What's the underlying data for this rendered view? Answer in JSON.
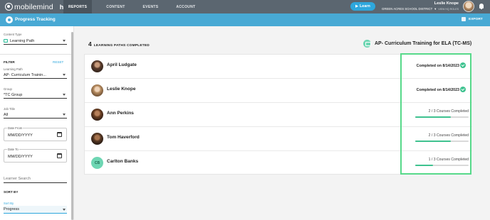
{
  "topbar": {
    "logo_text": "mobilemind",
    "logo_hq": "hq",
    "nav": [
      {
        "label": "REPORTS",
        "active": true
      },
      {
        "label": "CONTENT",
        "active": false
      },
      {
        "label": "EVENTS",
        "active": false
      },
      {
        "label": "ACCOUNT",
        "active": false
      }
    ],
    "learn_label": "Learn",
    "user_name": "Leslie Knope",
    "user_org": "GREEN ACRES SCHOOL DISTRICT",
    "view_roles": "VIEW HQ ROLES"
  },
  "title_bar": {
    "title": "Progress Tracking",
    "export_label": "EXPORT"
  },
  "sidebar": {
    "content_type_label": "Content Type",
    "content_type_value": "Learning Path",
    "filter_heading": "FILTER",
    "reset_label": "RESET",
    "learning_path_label": "Learning Path",
    "learning_path_value": "AP- Curriculum Trainin...",
    "group_label": "Group",
    "group_value": "*TC Group",
    "job_title_label": "Job Title",
    "job_title_value": "All",
    "date_from_label": "Date From",
    "date_from_placeholder": "MM/DD/YYYY",
    "date_to_label": "Date To",
    "date_to_placeholder": "MM/DD/YYYY",
    "learner_search_placeholder": "Learner Search",
    "sort_heading": "SORT BY",
    "sort_label": "Sort By",
    "sort_value": "Progress"
  },
  "main": {
    "count": "4",
    "count_label": "LEARNING PATHS COMPLETED",
    "path_title": "AP- Curriculum Training for ELA (TC-MS)",
    "learners": [
      {
        "name": "April Ludgate",
        "status": "completed",
        "status_text": "Completed on 8/14/2023",
        "avatar": "photo"
      },
      {
        "name": "Leslie Knope",
        "status": "completed",
        "status_text": "Completed on 8/14/2023",
        "avatar": "photo"
      },
      {
        "name": "Ann Perkins",
        "status": "in-progress",
        "status_text": "2 / 3 Courses Completed",
        "progress": 0.667,
        "avatar": "photo"
      },
      {
        "name": "Tom Haverford",
        "status": "in-progress",
        "status_text": "2 / 3 Courses Completed",
        "progress": 0.667,
        "avatar": "photo"
      },
      {
        "name": "Carlton Banks",
        "status": "in-progress",
        "status_text": "1 / 3 Courses Completed",
        "progress": 0.333,
        "avatar": "initials",
        "initials": "CB"
      }
    ]
  },
  "colors": {
    "topbar": "#5b6670",
    "accent": "#48a9d4",
    "learn_button": "#2ea7dd",
    "progress_fill": "#3ec28f",
    "highlight_border": "#57d98a"
  }
}
